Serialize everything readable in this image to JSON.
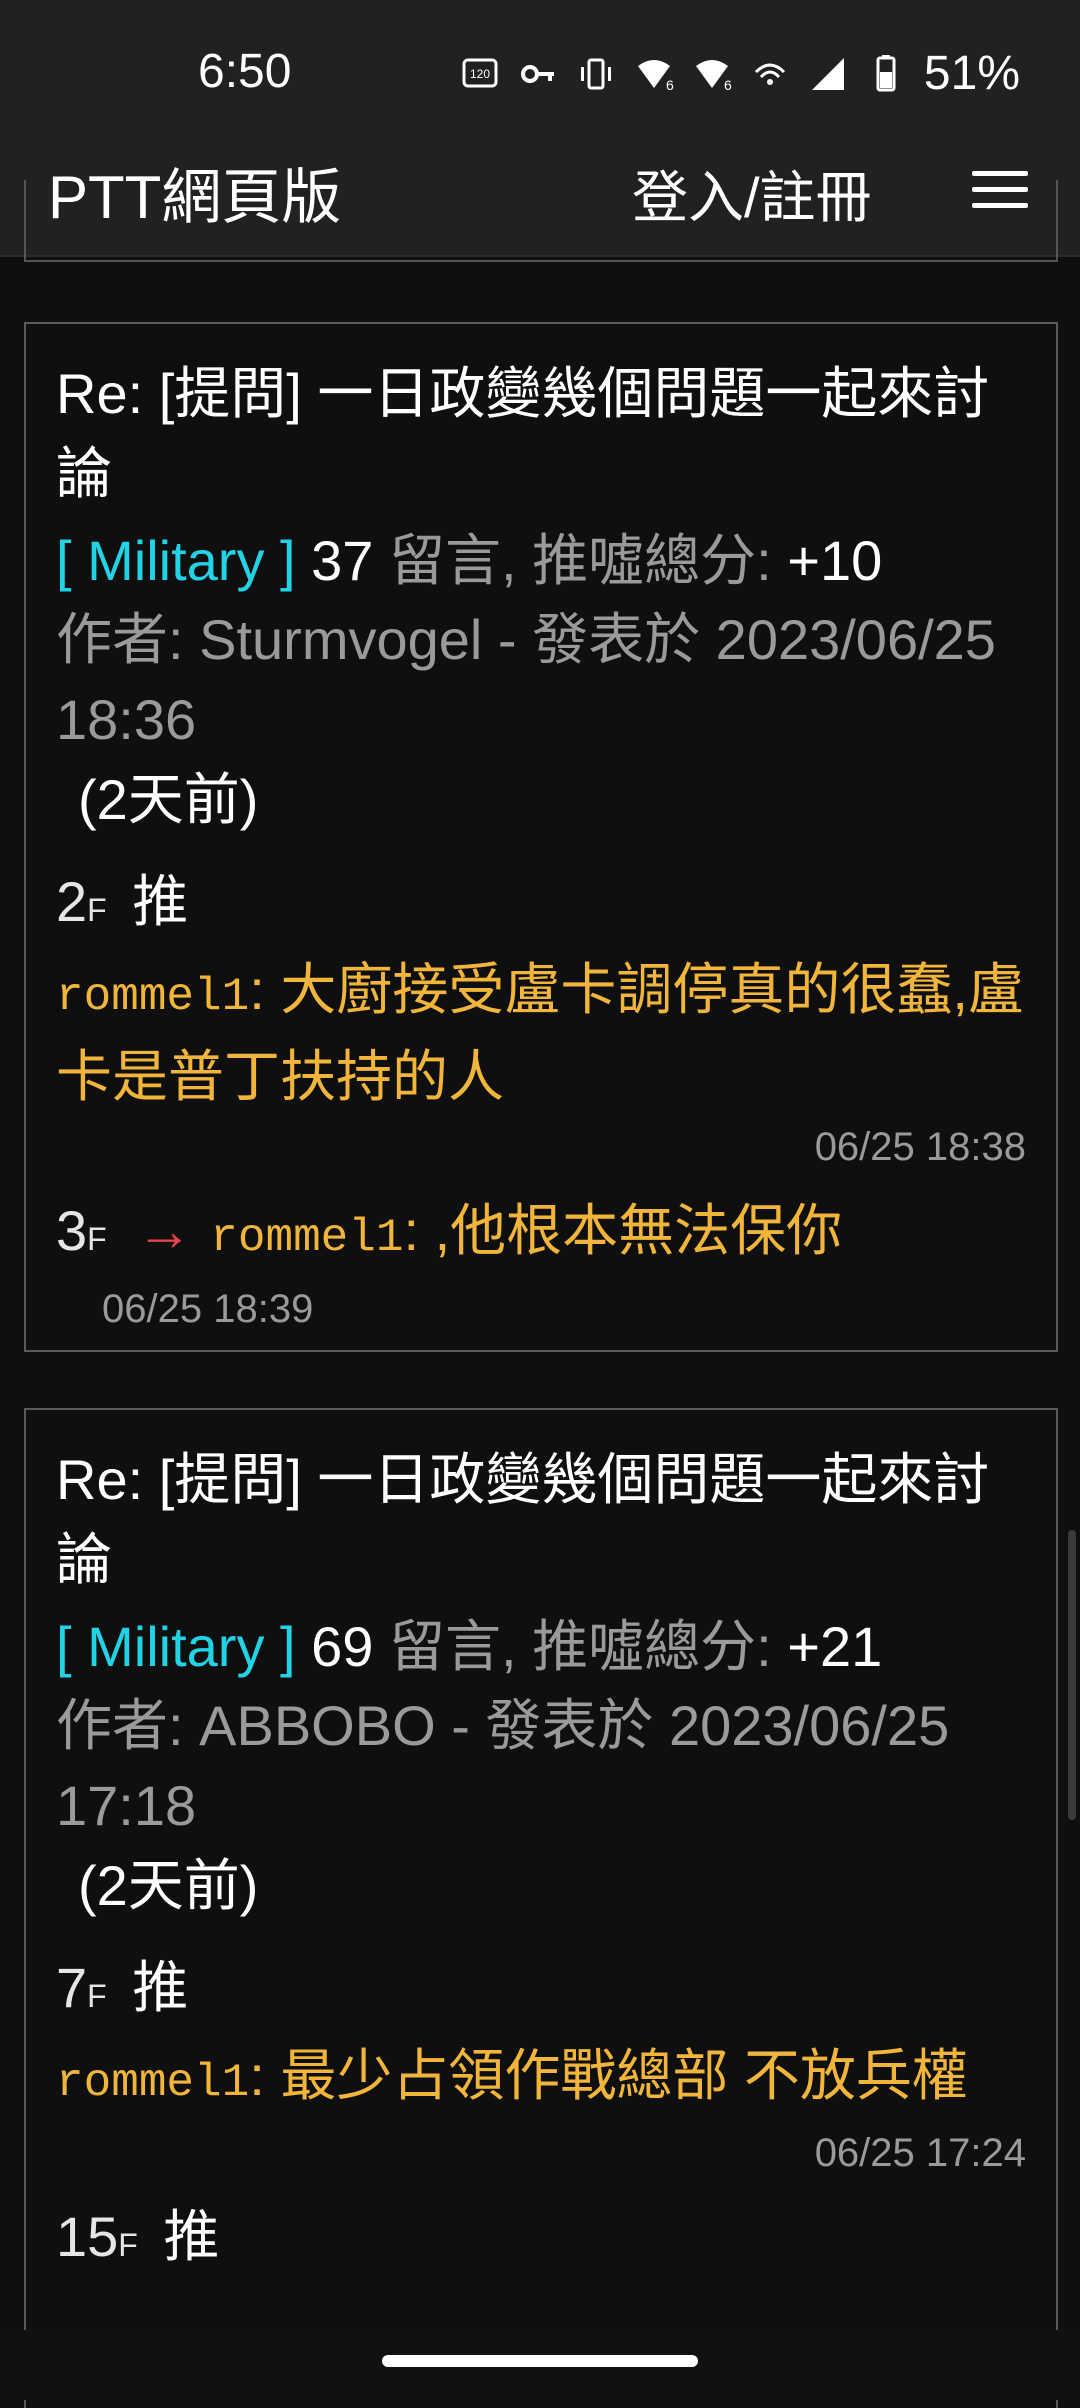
{
  "status": {
    "time": "6:50",
    "battery": "51%",
    "icons": [
      "120hz-icon",
      "vpn-key-icon",
      "vibrate-icon",
      "wifi-6-icon",
      "wifi-6-icon",
      "hotspot-icon",
      "signal-icon",
      "battery-icon"
    ]
  },
  "header": {
    "title": "PTT網頁版",
    "login": "登入/註冊"
  },
  "posts": [
    {
      "title": "Re: [提問] 一日政變幾個問題一起來討論",
      "board": "[ Military ]",
      "comment_count": "37",
      "comment_label": "留言, 推噓總分:",
      "score": "+10",
      "author_line": "作者: Sturmvogel - 發表於 2023/06/25 18:36",
      "ago": "(2天前)",
      "pushes": [
        {
          "floor": "2",
          "floor_suffix": "F",
          "tag": "推",
          "user": "rommel1",
          "text": "大廚接受盧卡調停真的很蠢,盧卡是普丁扶持的人",
          "time": "06/25 18:38"
        },
        {
          "floor": "3",
          "floor_suffix": "F",
          "tag": "→",
          "user": "rommel1",
          "text": ",他根本無法保你",
          "time": "06/25 18:39"
        }
      ]
    },
    {
      "title": "Re: [提問] 一日政變幾個問題一起來討論",
      "board": "[ Military ]",
      "comment_count": "69",
      "comment_label": "留言, 推噓總分:",
      "score": "+21",
      "author_line": "作者: ABBOBO - 發表於 2023/06/25 17:18",
      "ago": "(2天前)",
      "pushes": [
        {
          "floor": "7",
          "floor_suffix": "F",
          "tag": "推",
          "user": "rommel1",
          "text": "最少占領作戰總部 不放兵權",
          "time": "06/25 17:24"
        },
        {
          "floor": "15",
          "floor_suffix": "F",
          "tag": "推"
        }
      ]
    }
  ]
}
